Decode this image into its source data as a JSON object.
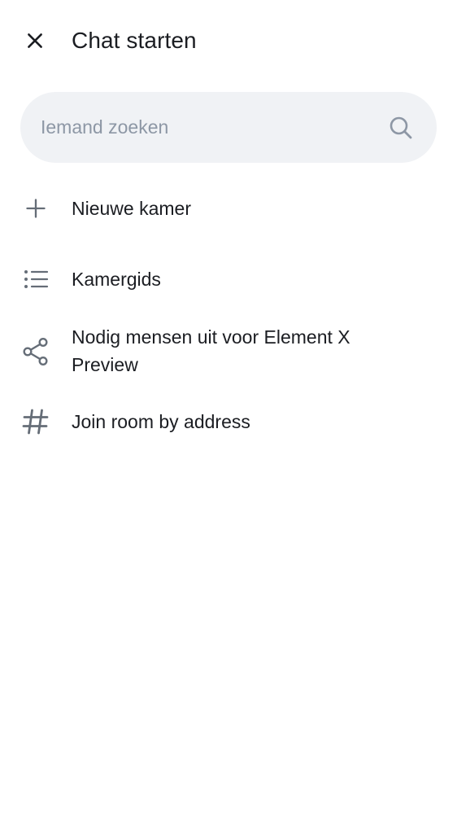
{
  "header": {
    "title": "Chat starten",
    "close_icon": "close-icon"
  },
  "search": {
    "placeholder": "Iemand zoeken",
    "value": "",
    "icon": "search-icon"
  },
  "menu": {
    "items": [
      {
        "label": "Nieuwe kamer",
        "icon": "plus-icon"
      },
      {
        "label": "Kamergids",
        "icon": "list-icon"
      },
      {
        "label": "Nodig mensen uit voor Element X Preview",
        "icon": "share-icon"
      },
      {
        "label": "Join room by address",
        "icon": "hash-icon"
      }
    ]
  },
  "colors": {
    "icon": "#656d77",
    "text": "#1b1d22",
    "search_bg": "#f0f2f5",
    "placeholder": "#8d97a5"
  }
}
